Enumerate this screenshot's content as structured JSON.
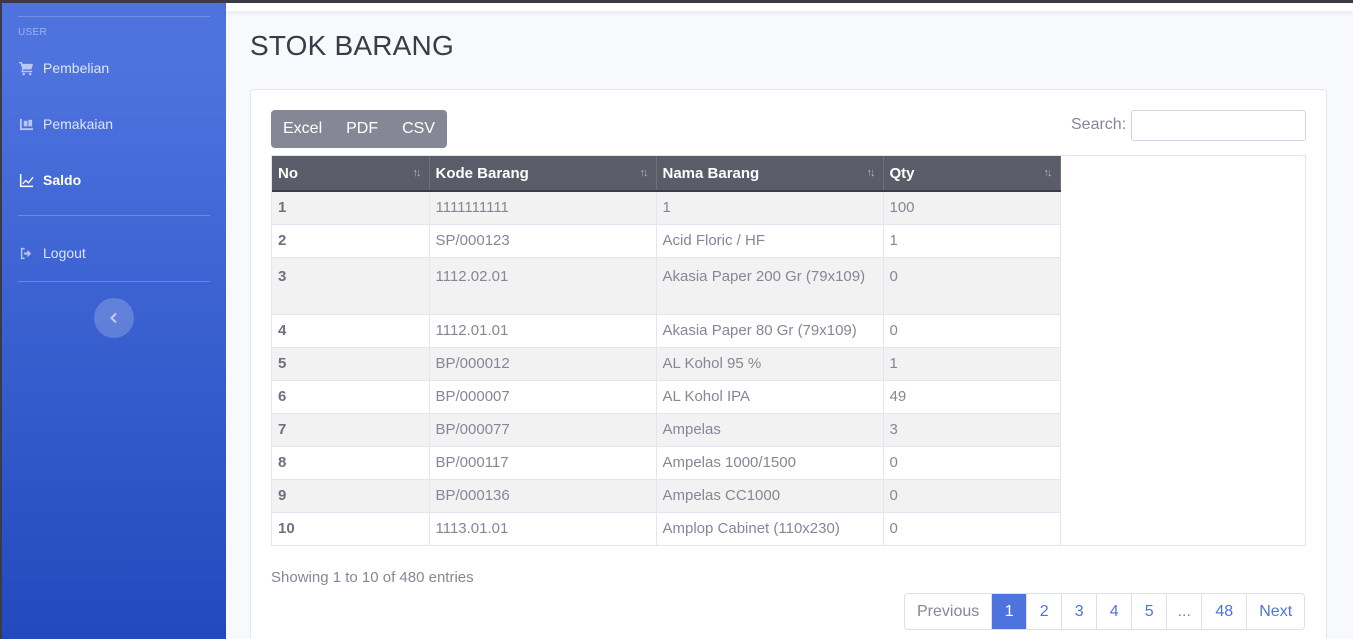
{
  "sidebar": {
    "heading": "USER",
    "items": [
      {
        "label": "Pembelian",
        "icon": "shopping-cart-icon",
        "active": false
      },
      {
        "label": "Pemakaian",
        "icon": "dolly-icon",
        "active": false
      },
      {
        "label": "Saldo",
        "icon": "chart-line-icon",
        "active": true
      },
      {
        "label": "Logout",
        "icon": "sign-out-icon",
        "active": false
      }
    ],
    "toggle_icon": "chevron-left-icon"
  },
  "page": {
    "title": "STOK BARANG"
  },
  "toolbar": {
    "export_buttons": [
      "Excel",
      "PDF",
      "CSV"
    ],
    "search_label": "Search:",
    "search_value": ""
  },
  "table": {
    "columns": [
      "No",
      "Kode Barang",
      "Nama Barang",
      "Qty"
    ],
    "rows": [
      {
        "no": "1",
        "kode": "1111111111",
        "nama": "1",
        "qty": "100"
      },
      {
        "no": "2",
        "kode": "SP/000123",
        "nama": "Acid Floric / HF",
        "qty": "1"
      },
      {
        "no": "3",
        "kode": "1112.02.01",
        "nama": "Akasia Paper 200 Gr (79x109)",
        "qty": "0"
      },
      {
        "no": "4",
        "kode": "1112.01.01",
        "nama": "Akasia Paper 80 Gr (79x109)",
        "qty": "0"
      },
      {
        "no": "5",
        "kode": "BP/000012",
        "nama": "AL Kohol 95 %",
        "qty": "1"
      },
      {
        "no": "6",
        "kode": "BP/000007",
        "nama": "AL Kohol IPA",
        "qty": "49"
      },
      {
        "no": "7",
        "kode": "BP/000077",
        "nama": "Ampelas",
        "qty": "3"
      },
      {
        "no": "8",
        "kode": "BP/000117",
        "nama": "Ampelas 1000/1500",
        "qty": "0"
      },
      {
        "no": "9",
        "kode": "BP/000136",
        "nama": "Ampelas CC1000",
        "qty": "0"
      },
      {
        "no": "10",
        "kode": "1113.01.01",
        "nama": "Amplop Cabinet (110x230)",
        "qty": "0"
      }
    ]
  },
  "footer": {
    "info": "Showing 1 to 10 of 480 entries",
    "pagination": {
      "previous": "Previous",
      "pages": [
        "1",
        "2",
        "3",
        "4",
        "5",
        "...",
        "48"
      ],
      "active_page": "1",
      "next": "Next"
    }
  },
  "colors": {
    "primary": "#4e73df",
    "sidebar_gradient_end": "#224abe",
    "header_dark": "#5a5c69",
    "secondary": "#858796"
  }
}
